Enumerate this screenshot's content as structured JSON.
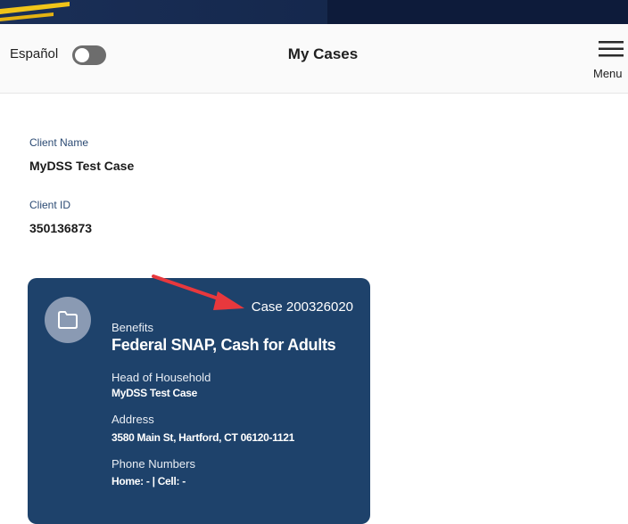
{
  "header": {
    "language_toggle_label": "Español",
    "title": "My Cases",
    "menu_label": "Menu"
  },
  "client": {
    "name_label": "Client Name",
    "name": "MyDSS Test Case",
    "id_label": "Client ID",
    "id": "350136873"
  },
  "case_card": {
    "case_number": "Case 200326020",
    "benefits_label": "Benefits",
    "benefits": "Federal SNAP, Cash for Adults",
    "head_label": "Head of Household",
    "head": "MyDSS Test Case",
    "address_label": "Address",
    "address": "3580 Main St, Hartford, CT 06120-1121",
    "phone_label": "Phone Numbers",
    "phones": "Home: - | Cell: -"
  },
  "colors": {
    "card": "#1e426b",
    "banner": "#15284d",
    "arrow": "#e8383d"
  },
  "icons": [
    "menu-icon",
    "folder-icon",
    "annotation-arrow"
  ]
}
